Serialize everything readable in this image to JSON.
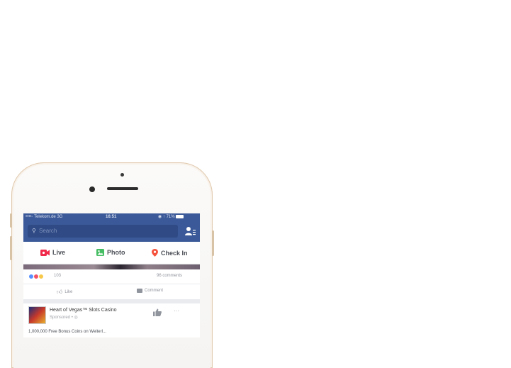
{
  "status_bar": {
    "carrier": "••••◦ Telekom.de  3G",
    "time": "16:51",
    "battery": "71%"
  },
  "nav": {
    "search_placeholder": "Search",
    "search_icon": "search-icon",
    "friends_icon": "friend-requests-icon"
  },
  "actions": {
    "live": "Live",
    "photo": "Photo",
    "check_in": "Check In"
  },
  "feed": {
    "reaction_count": "103",
    "comments_count": "96 comments",
    "like_label": "Like",
    "comment_label": "Comment",
    "sponsored_post": {
      "name": "Heart of Vegas™ Slots Casino",
      "subtitle": "Sponsored • ◎",
      "text": "1,000,000 Free Bonus Coins on Weiterl..."
    }
  },
  "colors": {
    "facebook_blue": "#3b5998",
    "live_red": "#f02849",
    "photo_green": "#45bd62",
    "checkin_pink": "#f5533d"
  }
}
